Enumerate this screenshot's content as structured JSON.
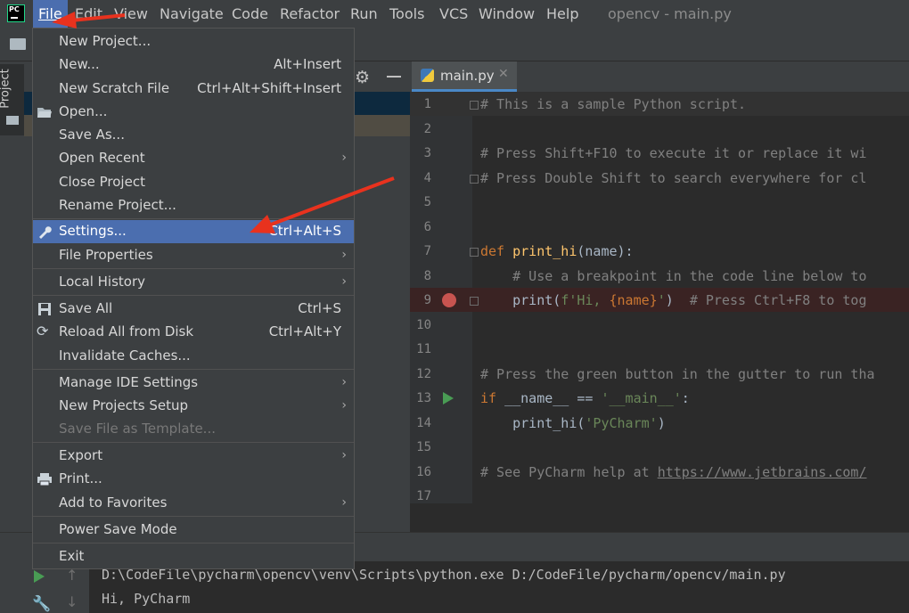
{
  "app": {
    "logo_text": "PC",
    "window_title": "opencv - main.py"
  },
  "menubar": {
    "items": [
      {
        "label": "File",
        "active": true
      },
      {
        "label": "Edit"
      },
      {
        "label": "View"
      },
      {
        "label": "Navigate"
      },
      {
        "label": "Code"
      },
      {
        "label": "Refactor"
      },
      {
        "label": "Run"
      },
      {
        "label": "Tools"
      },
      {
        "label": "VCS"
      },
      {
        "label": "Window"
      },
      {
        "label": "Help"
      }
    ]
  },
  "left_stripe": {
    "project_tab": "Project"
  },
  "editor": {
    "tab_label": "main.py",
    "line_numbers": [
      "1",
      "2",
      "3",
      "4",
      "5",
      "6",
      "7",
      "8",
      "9",
      "10",
      "11",
      "12",
      "13",
      "14",
      "15",
      "16",
      "17"
    ],
    "code": {
      "l1": "# This is a sample Python script.",
      "l3": "# Press Shift+F10 to execute it or replace it wi",
      "l4": "# Press Double Shift to search everywhere for cl",
      "l7_kw": "def ",
      "l7_fn": "print_hi",
      "l7_rest": "(name):",
      "l8": "    # Use a breakpoint in the code line below to",
      "l9_a": "    print(",
      "l9_str1": "f'Hi, ",
      "l9_var": "{name}",
      "l9_str2": "'",
      "l9_b": ")  ",
      "l9_cmt": "# Press Ctrl+F8 to tog",
      "l12": "# Press the green button in the gutter to run tha",
      "l13_kw": "if ",
      "l13_a": "__name__ == ",
      "l13_str": "'__main__'",
      "l13_b": ":",
      "l14_a": "    print_hi(",
      "l14_str": "'PyCharm'",
      "l14_b": ")",
      "l16_cmt": "# See PyCharm help at ",
      "l16_link": "https://www.jetbrains.com/"
    }
  },
  "console": {
    "line1": "D:\\CodeFile\\pycharm\\opencv\\venv\\Scripts\\python.exe D:/CodeFile/pycharm/opencv/main.py",
    "line2": "Hi, PyCharm"
  },
  "file_menu": {
    "new_project": "New Project...",
    "new": "New...",
    "new_sc": "Alt+Insert",
    "new_scratch": "New Scratch File",
    "new_scratch_sc": "Ctrl+Alt+Shift+Insert",
    "open": "Open...",
    "save_as": "Save As...",
    "open_recent": "Open Recent",
    "close_project": "Close Project",
    "rename_project": "Rename Project...",
    "settings": "Settings...",
    "settings_sc": "Ctrl+Alt+S",
    "file_properties": "File Properties",
    "local_history": "Local History",
    "save_all": "Save All",
    "save_all_sc": "Ctrl+S",
    "reload": "Reload All from Disk",
    "reload_sc": "Ctrl+Alt+Y",
    "invalidate": "Invalidate Caches...",
    "manage_ide": "Manage IDE Settings",
    "new_projects_setup": "New Projects Setup",
    "save_template": "Save File as Template...",
    "export": "Export",
    "print": "Print...",
    "favorites": "Add to Favorites",
    "power_save": "Power Save Mode",
    "exit": "Exit",
    "submenu_arrow": "›"
  },
  "colors": {
    "accent": "#4b6eaf",
    "annotation_arrow": "#e8321e",
    "breakpoint": "#c75450",
    "run": "#499c54"
  }
}
